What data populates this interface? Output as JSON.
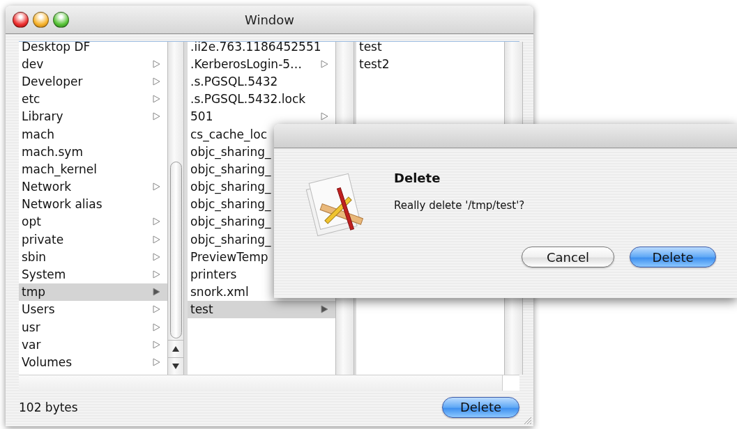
{
  "window": {
    "title": "Window"
  },
  "browser": {
    "columns": [
      {
        "items": [
          {
            "name": "Desktop DF",
            "expandable": false,
            "selected": false
          },
          {
            "name": "dev",
            "expandable": true,
            "selected": false
          },
          {
            "name": "Developer",
            "expandable": true,
            "selected": false
          },
          {
            "name": "etc",
            "expandable": true,
            "selected": false
          },
          {
            "name": "Library",
            "expandable": true,
            "selected": false
          },
          {
            "name": "mach",
            "expandable": false,
            "selected": false
          },
          {
            "name": "mach.sym",
            "expandable": false,
            "selected": false
          },
          {
            "name": "mach_kernel",
            "expandable": false,
            "selected": false
          },
          {
            "name": "Network",
            "expandable": true,
            "selected": false
          },
          {
            "name": "Network alias",
            "expandable": false,
            "selected": false
          },
          {
            "name": "opt",
            "expandable": true,
            "selected": false
          },
          {
            "name": "private",
            "expandable": true,
            "selected": false
          },
          {
            "name": "sbin",
            "expandable": true,
            "selected": false
          },
          {
            "name": "System",
            "expandable": true,
            "selected": false
          },
          {
            "name": "tmp",
            "expandable": true,
            "selected": true
          },
          {
            "name": "Users",
            "expandable": true,
            "selected": false
          },
          {
            "name": "usr",
            "expandable": true,
            "selected": false
          },
          {
            "name": "var",
            "expandable": true,
            "selected": false
          },
          {
            "name": "Volumes",
            "expandable": true,
            "selected": false
          }
        ]
      },
      {
        "items": [
          {
            "name": ".ii2e.763.1186452551",
            "expandable": false,
            "selected": false
          },
          {
            "name": ".KerberosLogin-5…",
            "expandable": true,
            "selected": false
          },
          {
            "name": ".s.PGSQL.5432",
            "expandable": false,
            "selected": false
          },
          {
            "name": ".s.PGSQL.5432.lock",
            "expandable": false,
            "selected": false
          },
          {
            "name": "501",
            "expandable": true,
            "selected": false
          },
          {
            "name": "cs_cache_loc",
            "selected": false
          },
          {
            "name": "objc_sharing_",
            "selected": false
          },
          {
            "name": "objc_sharing_",
            "selected": false
          },
          {
            "name": "objc_sharing_",
            "selected": false
          },
          {
            "name": "objc_sharing_",
            "selected": false
          },
          {
            "name": "objc_sharing_",
            "selected": false
          },
          {
            "name": "objc_sharing_",
            "selected": false
          },
          {
            "name": "PreviewTemp",
            "selected": false
          },
          {
            "name": "printers",
            "selected": false
          },
          {
            "name": "snork.xml",
            "selected": false
          },
          {
            "name": "test",
            "expandable": true,
            "selected": true
          }
        ]
      },
      {
        "items": [
          {
            "name": "test",
            "expandable": false,
            "selected": false
          },
          {
            "name": "test2",
            "expandable": false,
            "selected": false
          }
        ]
      }
    ]
  },
  "status": {
    "text": "102 bytes"
  },
  "buttons": [
    {
      "label": "Delete",
      "default": true
    }
  ],
  "dialog": {
    "title": "Delete",
    "message": "Really delete '/tmp/test'?",
    "buttons": [
      {
        "label": "Cancel",
        "default": false
      },
      {
        "label": "Delete",
        "default": true
      }
    ]
  }
}
